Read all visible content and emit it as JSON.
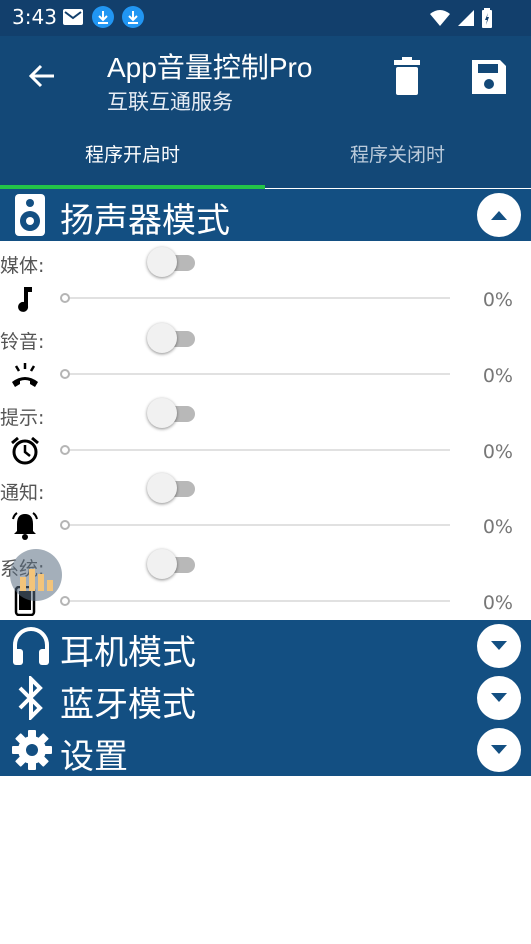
{
  "status_bar": {
    "time": "3:43",
    "left_icons": [
      "gmail-icon",
      "download-icon",
      "download-icon"
    ],
    "right_icons": [
      "wifi-icon",
      "signal-icon",
      "battery-icon"
    ]
  },
  "app_bar": {
    "title": "App音量控制Pro",
    "subtitle": "互联互通服务",
    "icons": [
      "back-arrow-icon",
      "trash-icon",
      "save-icon"
    ]
  },
  "tabs": [
    {
      "label": "程序开启时",
      "active": true
    },
    {
      "label": "程序关闭时",
      "active": false
    }
  ],
  "speaker_section": {
    "title": "扬声器模式",
    "icon": "speaker-icon",
    "expanded": true,
    "rows": [
      {
        "label": "媒体:",
        "icon": "music-note-icon",
        "enabled": false,
        "percent": "0%"
      },
      {
        "label": "铃音:",
        "icon": "phone-ring-icon",
        "enabled": false,
        "percent": "0%"
      },
      {
        "label": "提示:",
        "icon": "alarm-clock-icon",
        "enabled": false,
        "percent": "0%"
      },
      {
        "label": "通知:",
        "icon": "bell-icon",
        "enabled": false,
        "percent": "0%"
      },
      {
        "label": "系统:",
        "icon": "phone-icon",
        "enabled": false,
        "percent": "0%"
      }
    ]
  },
  "collapsed_sections": [
    {
      "title": "耳机模式",
      "icon": "headphones-icon"
    },
    {
      "title": "蓝牙模式",
      "icon": "bluetooth-icon"
    },
    {
      "title": "设置",
      "icon": "gear-icon"
    }
  ],
  "colors": {
    "primary": "#134877",
    "section": "#134f82",
    "tab_indicator": "#23c548"
  }
}
